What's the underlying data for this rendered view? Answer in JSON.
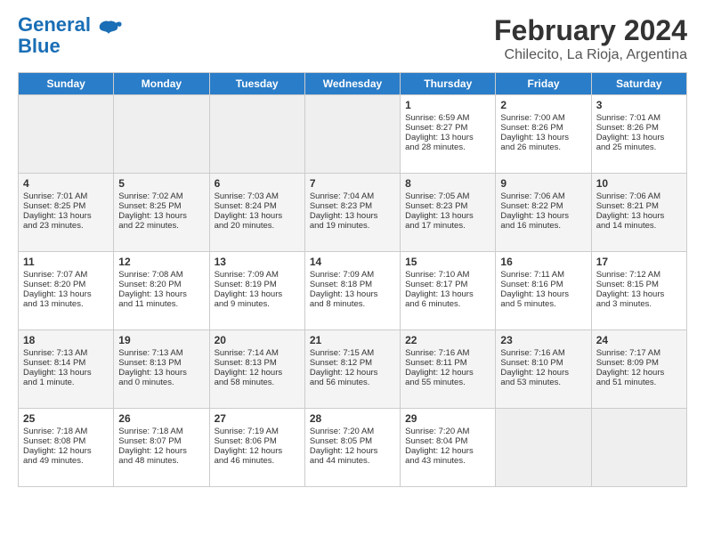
{
  "header": {
    "logo_line1": "General",
    "logo_line2": "Blue",
    "main_title": "February 2024",
    "subtitle": "Chilecito, La Rioja, Argentina"
  },
  "days_of_week": [
    "Sunday",
    "Monday",
    "Tuesday",
    "Wednesday",
    "Thursday",
    "Friday",
    "Saturday"
  ],
  "weeks": [
    [
      {
        "day": "",
        "empty": true
      },
      {
        "day": "",
        "empty": true
      },
      {
        "day": "",
        "empty": true
      },
      {
        "day": "",
        "empty": true
      },
      {
        "day": "1",
        "line1": "Sunrise: 6:59 AM",
        "line2": "Sunset: 8:27 PM",
        "line3": "Daylight: 13 hours",
        "line4": "and 28 minutes."
      },
      {
        "day": "2",
        "line1": "Sunrise: 7:00 AM",
        "line2": "Sunset: 8:26 PM",
        "line3": "Daylight: 13 hours",
        "line4": "and 26 minutes."
      },
      {
        "day": "3",
        "line1": "Sunrise: 7:01 AM",
        "line2": "Sunset: 8:26 PM",
        "line3": "Daylight: 13 hours",
        "line4": "and 25 minutes."
      }
    ],
    [
      {
        "day": "4",
        "line1": "Sunrise: 7:01 AM",
        "line2": "Sunset: 8:25 PM",
        "line3": "Daylight: 13 hours",
        "line4": "and 23 minutes."
      },
      {
        "day": "5",
        "line1": "Sunrise: 7:02 AM",
        "line2": "Sunset: 8:25 PM",
        "line3": "Daylight: 13 hours",
        "line4": "and 22 minutes."
      },
      {
        "day": "6",
        "line1": "Sunrise: 7:03 AM",
        "line2": "Sunset: 8:24 PM",
        "line3": "Daylight: 13 hours",
        "line4": "and 20 minutes."
      },
      {
        "day": "7",
        "line1": "Sunrise: 7:04 AM",
        "line2": "Sunset: 8:23 PM",
        "line3": "Daylight: 13 hours",
        "line4": "and 19 minutes."
      },
      {
        "day": "8",
        "line1": "Sunrise: 7:05 AM",
        "line2": "Sunset: 8:23 PM",
        "line3": "Daylight: 13 hours",
        "line4": "and 17 minutes."
      },
      {
        "day": "9",
        "line1": "Sunrise: 7:06 AM",
        "line2": "Sunset: 8:22 PM",
        "line3": "Daylight: 13 hours",
        "line4": "and 16 minutes."
      },
      {
        "day": "10",
        "line1": "Sunrise: 7:06 AM",
        "line2": "Sunset: 8:21 PM",
        "line3": "Daylight: 13 hours",
        "line4": "and 14 minutes."
      }
    ],
    [
      {
        "day": "11",
        "line1": "Sunrise: 7:07 AM",
        "line2": "Sunset: 8:20 PM",
        "line3": "Daylight: 13 hours",
        "line4": "and 13 minutes."
      },
      {
        "day": "12",
        "line1": "Sunrise: 7:08 AM",
        "line2": "Sunset: 8:20 PM",
        "line3": "Daylight: 13 hours",
        "line4": "and 11 minutes."
      },
      {
        "day": "13",
        "line1": "Sunrise: 7:09 AM",
        "line2": "Sunset: 8:19 PM",
        "line3": "Daylight: 13 hours",
        "line4": "and 9 minutes."
      },
      {
        "day": "14",
        "line1": "Sunrise: 7:09 AM",
        "line2": "Sunset: 8:18 PM",
        "line3": "Daylight: 13 hours",
        "line4": "and 8 minutes."
      },
      {
        "day": "15",
        "line1": "Sunrise: 7:10 AM",
        "line2": "Sunset: 8:17 PM",
        "line3": "Daylight: 13 hours",
        "line4": "and 6 minutes."
      },
      {
        "day": "16",
        "line1": "Sunrise: 7:11 AM",
        "line2": "Sunset: 8:16 PM",
        "line3": "Daylight: 13 hours",
        "line4": "and 5 minutes."
      },
      {
        "day": "17",
        "line1": "Sunrise: 7:12 AM",
        "line2": "Sunset: 8:15 PM",
        "line3": "Daylight: 13 hours",
        "line4": "and 3 minutes."
      }
    ],
    [
      {
        "day": "18",
        "line1": "Sunrise: 7:13 AM",
        "line2": "Sunset: 8:14 PM",
        "line3": "Daylight: 13 hours",
        "line4": "and 1 minute."
      },
      {
        "day": "19",
        "line1": "Sunrise: 7:13 AM",
        "line2": "Sunset: 8:13 PM",
        "line3": "Daylight: 13 hours",
        "line4": "and 0 minutes."
      },
      {
        "day": "20",
        "line1": "Sunrise: 7:14 AM",
        "line2": "Sunset: 8:13 PM",
        "line3": "Daylight: 12 hours",
        "line4": "and 58 minutes."
      },
      {
        "day": "21",
        "line1": "Sunrise: 7:15 AM",
        "line2": "Sunset: 8:12 PM",
        "line3": "Daylight: 12 hours",
        "line4": "and 56 minutes."
      },
      {
        "day": "22",
        "line1": "Sunrise: 7:16 AM",
        "line2": "Sunset: 8:11 PM",
        "line3": "Daylight: 12 hours",
        "line4": "and 55 minutes."
      },
      {
        "day": "23",
        "line1": "Sunrise: 7:16 AM",
        "line2": "Sunset: 8:10 PM",
        "line3": "Daylight: 12 hours",
        "line4": "and 53 minutes."
      },
      {
        "day": "24",
        "line1": "Sunrise: 7:17 AM",
        "line2": "Sunset: 8:09 PM",
        "line3": "Daylight: 12 hours",
        "line4": "and 51 minutes."
      }
    ],
    [
      {
        "day": "25",
        "line1": "Sunrise: 7:18 AM",
        "line2": "Sunset: 8:08 PM",
        "line3": "Daylight: 12 hours",
        "line4": "and 49 minutes."
      },
      {
        "day": "26",
        "line1": "Sunrise: 7:18 AM",
        "line2": "Sunset: 8:07 PM",
        "line3": "Daylight: 12 hours",
        "line4": "and 48 minutes."
      },
      {
        "day": "27",
        "line1": "Sunrise: 7:19 AM",
        "line2": "Sunset: 8:06 PM",
        "line3": "Daylight: 12 hours",
        "line4": "and 46 minutes."
      },
      {
        "day": "28",
        "line1": "Sunrise: 7:20 AM",
        "line2": "Sunset: 8:05 PM",
        "line3": "Daylight: 12 hours",
        "line4": "and 44 minutes."
      },
      {
        "day": "29",
        "line1": "Sunrise: 7:20 AM",
        "line2": "Sunset: 8:04 PM",
        "line3": "Daylight: 12 hours",
        "line4": "and 43 minutes."
      },
      {
        "day": "",
        "empty": true
      },
      {
        "day": "",
        "empty": true
      }
    ]
  ]
}
